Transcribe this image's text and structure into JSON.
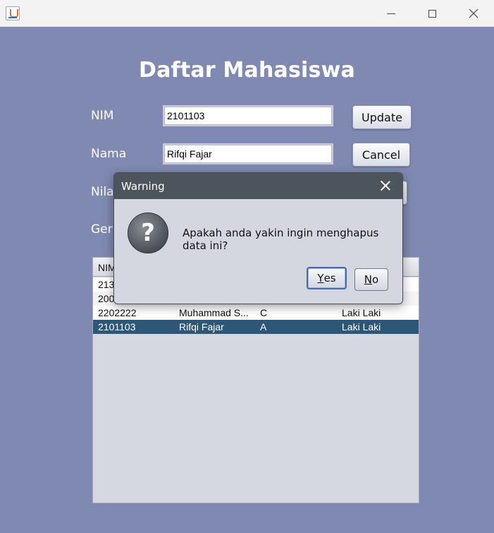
{
  "window": {
    "icon": "java-cup-icon",
    "controls": [
      "minimize-icon",
      "maximize-icon",
      "close-icon"
    ]
  },
  "form": {
    "title": "Daftar Mahasiswa",
    "nim_label": "NIM",
    "nim_value": "2101103",
    "nama_label": "Nama",
    "nama_value": "Rifqi Fajar",
    "nilai_label_visible": "Nila",
    "gender_label_visible": "Ger",
    "update_label": "Update",
    "cancel_label": "Cancel"
  },
  "table": {
    "header_visible": "NIM",
    "rows": [
      {
        "nim": "213"
      },
      {
        "nim": "200"
      },
      {
        "nim": "2202222",
        "nama": "Muhammad S...",
        "nilai": "C",
        "gender": "Laki Laki"
      },
      {
        "nim": "2101103",
        "nama": "Rifqi Fajar",
        "nilai": "A",
        "gender": "Laki Laki",
        "selected": true
      }
    ]
  },
  "dialog": {
    "title": "Warning",
    "icon": "question-icon",
    "message": "Apakah anda yakin ingin menghapus data ini?",
    "yes_mnemonic": "Y",
    "yes_rest": "es",
    "no_mnemonic": "N",
    "no_rest": "o"
  },
  "colors": {
    "background": "#7f89b1",
    "dialog_title_bar": "#4d545c",
    "selected_row": "#2e5676"
  }
}
